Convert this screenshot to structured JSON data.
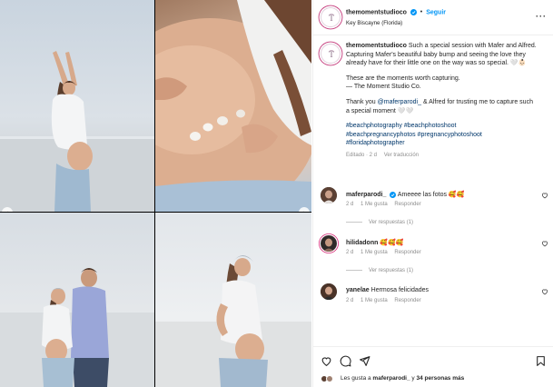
{
  "media": {
    "photos": [
      {
        "name": "photo-beach-stretch"
      },
      {
        "name": "photo-belly-shells"
      },
      {
        "name": "photo-couple-beach"
      },
      {
        "name": "photo-beach-portrait"
      }
    ],
    "nav": {
      "prev": "‹",
      "next": "›"
    }
  },
  "header": {
    "username": "themomentstudioco",
    "separator": "•",
    "follow": "Seguir",
    "location": "Key Biscayne (Florida)",
    "more": "···"
  },
  "caption": {
    "username": "themomentstudioco",
    "text1": "Such a special session with Mafer and Alfred. Capturing Mafer's beautiful baby bump and seeing the love they already have for their little one on the way was so special. 🤍👶🏻",
    "text2_line1": "These are the moments worth capturing.",
    "text2_line2": "— The Moment Studio Co.",
    "text3_prefix": "Thank you",
    "mention": "@maferparodi_",
    "text3_suffix": "& Alfred for trusting me to capture such a special moment 🤍🤍",
    "hashtags_line1": "#beachphotography #beachphotoshoot",
    "hashtags_line2": "#beachpregnancyphotos #pregnancyphotoshoot",
    "hashtags_line3": "#floridaphotographer",
    "edited": "Editado · 2 d",
    "translation": "Ver traducción"
  },
  "comments": [
    {
      "username": "maferparodi_",
      "text": "Ameeee las fotos 🥰🥰",
      "time": "2 d",
      "likes": "1 Me gusta",
      "reply": "Responder",
      "replies": "Ver respuestas (1)"
    },
    {
      "username": "hilidadonn",
      "text": "🥰🥰🥰",
      "time": "2 d",
      "likes": "1 Me gusta",
      "reply": "Responder",
      "replies": "Ver respuestas (1)"
    },
    {
      "username": "yanelae",
      "text": "Hermosa felicidades",
      "time": "2 d",
      "likes": "1 Me gusta",
      "reply": "Responder"
    }
  ],
  "likes": {
    "prefix": "Les gusta a",
    "user": "maferparodi_",
    "conjunction": "y",
    "others": "34 personas más"
  },
  "colors": {
    "link_blue": "#0095f6",
    "verified_blue": "#0095f6",
    "hashtag": "#00376b",
    "secondary_text": "#8e8e8e",
    "ring": "#c43a7b"
  },
  "icons": [
    "verified-icon",
    "heart-icon",
    "comment-icon",
    "share-icon",
    "bookmark-icon",
    "more-icon",
    "chevron-left-icon",
    "chevron-right-icon"
  ]
}
